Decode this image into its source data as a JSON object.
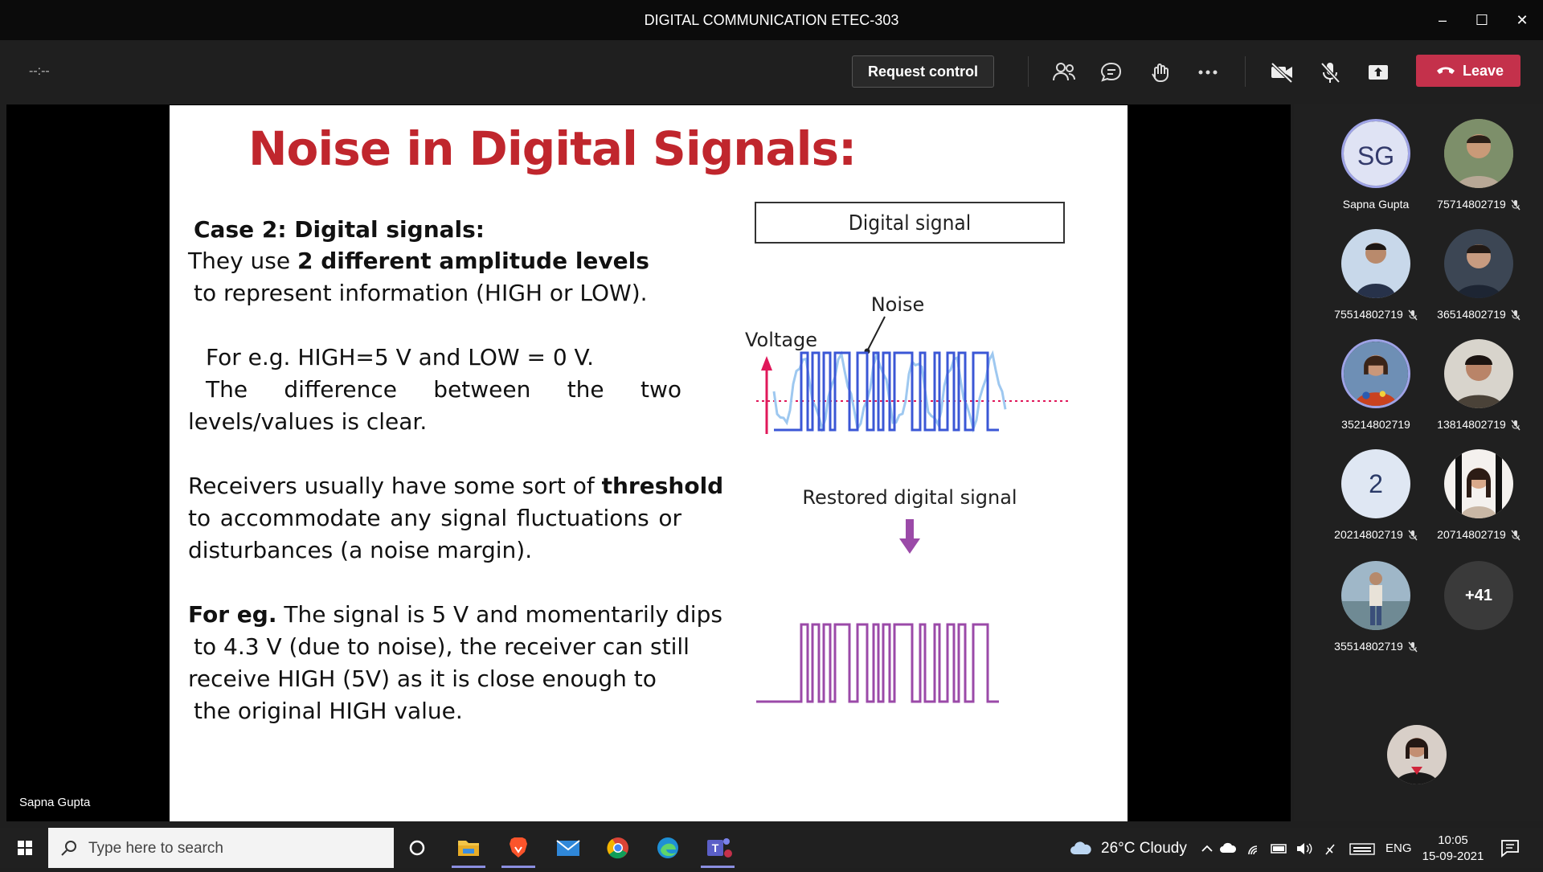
{
  "window": {
    "title": "DIGITAL COMMUNICATION ETEC-303"
  },
  "toolbar": {
    "timer": "--:--",
    "request_control": "Request control",
    "leave": "Leave"
  },
  "slide": {
    "title": "Noise in Digital Signals:",
    "case_heading": "Case 2: Digital signals:",
    "l1_pre": "They use ",
    "l1_bold": "2 different amplitude levels",
    "l2": "to represent information (HIGH or LOW).",
    "l3": "For e.g. HIGH=5 V and LOW = 0 V.",
    "l4": "The difference between the two",
    "l5": "levels/values is clear.",
    "l6_pre": "Receivers usually have some sort of ",
    "l6_bold": "threshold",
    "l7": "to accommodate any signal fluctuations or",
    "l8": "disturbances (a noise margin).",
    "l9_bold": "For eg.",
    "l9_rest": " The signal is 5 V and momentarily dips",
    "l10": "to 4.3 V (due to noise), the receiver can still",
    "l11": "receive HIGH (5V) as it is close enough to",
    "l12": "the original HIGH value.",
    "diagram": {
      "box_label": "Digital signal",
      "noise_label": "Noise",
      "voltage_label": "Voltage",
      "restored_label": "Restored digital signal"
    }
  },
  "stage": {
    "presenter_name": "Sapna Gupta"
  },
  "participants": [
    {
      "name": "Sapna Gupta",
      "initials": "SG",
      "muted": false
    },
    {
      "name": "75714802719",
      "muted": true
    },
    {
      "name": "75514802719",
      "muted": true
    },
    {
      "name": "36514802719",
      "muted": true
    },
    {
      "name": "35214802719",
      "muted": false
    },
    {
      "name": "13814802719",
      "muted": true
    },
    {
      "name": "20214802719",
      "initials": "2",
      "muted": true
    },
    {
      "name": "20714802719",
      "muted": true
    },
    {
      "name": "35514802719",
      "muted": true
    },
    {
      "name": "",
      "initials": "+41"
    }
  ],
  "taskbar": {
    "search_placeholder": "Type here to search",
    "weather": "26°C  Cloudy",
    "lang": "ENG",
    "time": "10:05",
    "date": "15-09-2021"
  },
  "colors": {
    "accent": "#c0262d",
    "leave": "#c4314b",
    "signal_blue": "#3b57d6",
    "signal_purple": "#9b4aa8"
  }
}
